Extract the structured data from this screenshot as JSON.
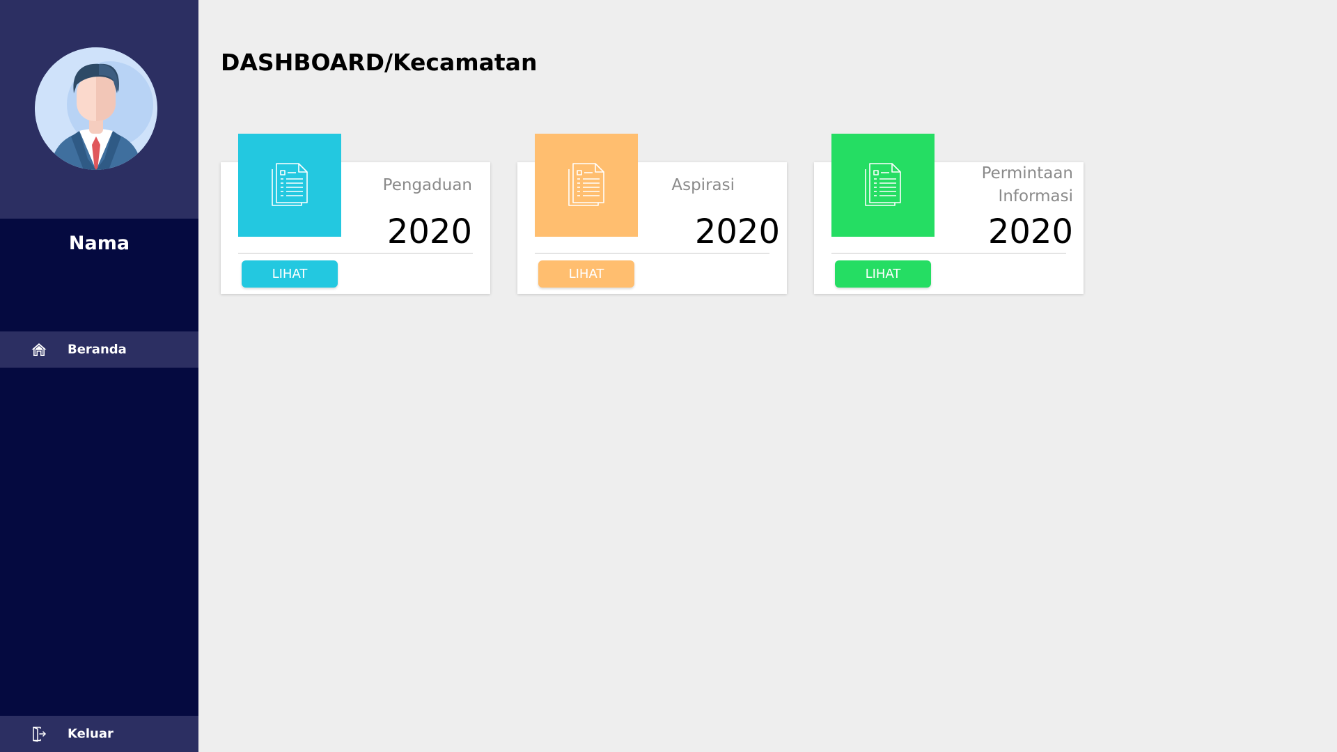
{
  "sidebar": {
    "user_name": "Nama",
    "avatar_icon": "user-avatar-icon",
    "nav": [
      {
        "label": "Beranda",
        "icon": "home-icon"
      },
      {
        "label": "Keluar",
        "icon": "logout-icon"
      }
    ]
  },
  "header": {
    "title_strong": "DASHBOARD/",
    "title_rest": "Kecamatan"
  },
  "cards": [
    {
      "title": "Pengaduan",
      "value": "2020",
      "button_label": "LIHAT",
      "color": "#23c8e0",
      "icon": "document-icon"
    },
    {
      "title": "Aspirasi",
      "value": "2020",
      "button_label": "LIHAT",
      "color": "#ffbe6f",
      "icon": "document-icon"
    },
    {
      "title": "Permintaan Informasi",
      "value": "2020",
      "button_label": "LIHAT",
      "color": "#25dd63",
      "icon": "document-icon"
    }
  ],
  "colors": {
    "sidebar_dark": "#050a40",
    "sidebar_light": "#2c2f62",
    "background": "#eeeeee"
  }
}
